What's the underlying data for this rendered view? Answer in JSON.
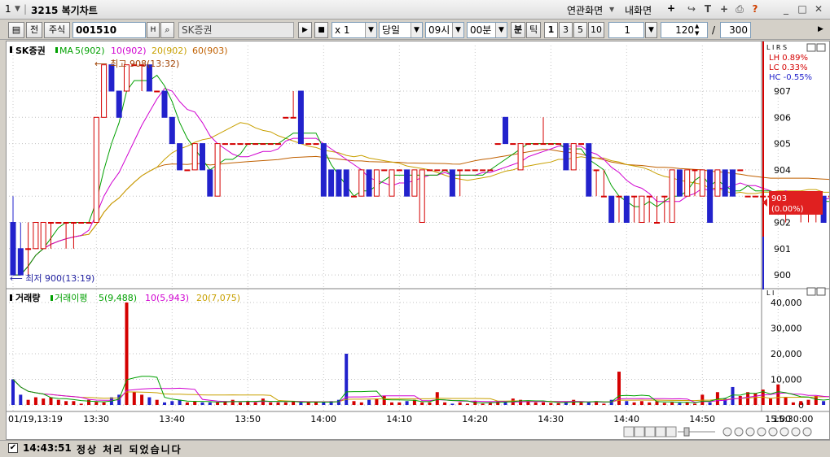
{
  "window": {
    "screen_no": "1",
    "title": "3215  복기차트",
    "link_screen": "연관화면",
    "my_screen": "내화면"
  },
  "toolbar": {
    "prefix": "전",
    "market": "주식",
    "code": "001510",
    "h_label": "H",
    "stock_name": "SK증권",
    "multiplier": "x 1",
    "period": "당일",
    "start_time": "09시",
    "start_minute": "00분",
    "unit_min": "분",
    "unit_tick": "틱",
    "intervals": [
      "1",
      "3",
      "5",
      "10"
    ],
    "interval_value": "1",
    "view_count": "120",
    "total_count": "300"
  },
  "price_panel": {
    "legend": {
      "name": "SK증권",
      "ma_label": "MA",
      "ma5": "5(902)",
      "ma10": "10(902)",
      "ma20": "20(902)",
      "ma60": "60(903)"
    },
    "high_note": "최고 908(13:32)",
    "low_note": "최저 900(13:19)",
    "corner_label": "L I R S",
    "stats": {
      "lh": "LH   0.89%",
      "lc": "LC   0.33%",
      "hc": "HC  -0.55%"
    },
    "current_price": "903",
    "current_change": "(0.00%)",
    "y_ticks": [
      "907",
      "906",
      "905",
      "904",
      "903",
      "902",
      "901",
      "900"
    ]
  },
  "volume_panel": {
    "legend": {
      "name": "거래량",
      "avg_label": "거래이평",
      "avg5": "5(9,488)",
      "avg10": "10(5,943)",
      "avg20": "20(7,075)"
    },
    "corner_label": "L I",
    "y_ticks": [
      "40,000",
      "30,000",
      "20,000",
      "10,000",
      "0"
    ]
  },
  "x_axis": {
    "labels": [
      "01/19,13:19",
      "13:30",
      "13:40",
      "13:50",
      "14:00",
      "14:10",
      "14:20",
      "14:30",
      "14:40",
      "14:50",
      "15:00",
      "15:10"
    ],
    "end_label": "15:30:00"
  },
  "colors": {
    "up": "#d40000",
    "down": "#2222cc",
    "ma5": "#00a000",
    "ma10": "#d000d0",
    "ma20": "#c8a000",
    "ma60": "#c06000"
  },
  "status": {
    "time": "14:43:51",
    "message": "정상 처리 되었습니다"
  },
  "chart_data": [
    {
      "type": "candlestick",
      "title": "SK증권",
      "x_start": "13:19",
      "x_interval_minutes": 1,
      "ylim": [
        899.5,
        908.5
      ],
      "candles": [
        [
          902,
          903,
          900,
          900
        ],
        [
          901,
          902,
          900,
          900
        ],
        [
          901,
          902,
          900,
          901
        ],
        [
          901,
          902,
          901,
          902
        ],
        [
          901,
          902,
          901,
          902
        ],
        [
          902,
          902,
          901,
          902
        ],
        [
          902,
          902,
          902,
          902
        ],
        [
          902,
          902,
          901,
          902
        ],
        [
          902,
          902,
          901,
          902
        ],
        [
          902,
          902,
          902,
          902
        ],
        [
          902,
          902,
          902,
          902
        ],
        [
          902,
          906,
          902,
          906
        ],
        [
          906,
          908,
          906,
          908
        ],
        [
          908,
          908,
          907,
          907
        ],
        [
          907,
          907,
          906,
          906
        ],
        [
          907,
          908,
          907,
          908
        ],
        [
          908,
          908,
          908,
          908
        ],
        [
          908,
          908,
          907,
          908
        ],
        [
          908,
          908,
          907,
          907
        ],
        [
          907,
          907,
          907,
          907
        ],
        [
          907,
          907,
          906,
          906
        ],
        [
          906,
          906,
          905,
          905
        ],
        [
          905,
          905,
          904,
          904
        ],
        [
          904,
          904,
          904,
          904
        ],
        [
          904,
          905,
          904,
          905
        ],
        [
          905,
          905,
          904,
          904
        ],
        [
          904,
          904,
          903,
          903
        ],
        [
          903,
          905,
          903,
          905
        ],
        [
          905,
          905,
          905,
          905
        ],
        [
          905,
          905,
          905,
          905
        ],
        [
          905,
          905,
          905,
          905
        ],
        [
          905,
          905,
          905,
          905
        ],
        [
          905,
          905,
          905,
          905
        ],
        [
          905,
          905,
          905,
          905
        ],
        [
          905,
          905,
          905,
          905
        ],
        [
          905,
          905,
          905,
          905
        ],
        [
          906,
          906,
          906,
          906
        ],
        [
          906,
          907,
          906,
          906
        ],
        [
          907,
          907,
          905,
          905
        ],
        [
          905,
          905,
          905,
          905
        ],
        [
          905,
          905,
          905,
          905
        ],
        [
          905,
          905,
          903,
          903
        ],
        [
          904,
          904,
          903,
          903
        ],
        [
          904,
          904,
          903,
          903
        ],
        [
          904,
          904,
          903,
          903
        ],
        [
          903,
          903,
          903,
          903
        ],
        [
          903,
          904,
          903,
          904
        ],
        [
          904,
          904,
          903,
          903
        ],
        [
          903,
          904,
          903,
          904
        ],
        [
          904,
          904,
          904,
          904
        ],
        [
          903,
          904,
          903,
          904
        ],
        [
          904,
          904,
          904,
          904
        ],
        [
          904,
          904,
          903,
          903
        ],
        [
          903,
          904,
          903,
          904
        ],
        [
          902,
          904,
          902,
          904
        ],
        [
          904,
          904,
          904,
          904
        ],
        [
          904,
          904,
          904,
          904
        ],
        [
          904,
          904,
          904,
          904
        ],
        [
          904,
          904,
          903,
          903
        ],
        [
          904,
          904,
          903,
          904
        ],
        [
          904,
          904,
          904,
          904
        ],
        [
          904,
          904,
          904,
          904
        ],
        [
          904,
          904,
          904,
          904
        ],
        [
          904,
          904,
          904,
          904
        ],
        [
          905,
          905,
          905,
          905
        ],
        [
          906,
          906,
          905,
          905
        ],
        [
          905,
          905,
          905,
          905
        ],
        [
          904,
          905,
          904,
          905
        ],
        [
          905,
          905,
          905,
          905
        ],
        [
          905,
          905,
          905,
          905
        ],
        [
          905,
          906,
          905,
          905
        ],
        [
          905,
          905,
          905,
          905
        ],
        [
          905,
          905,
          905,
          905
        ],
        [
          905,
          905,
          904,
          904
        ],
        [
          904,
          905,
          904,
          905
        ],
        [
          905,
          905,
          905,
          905
        ],
        [
          905,
          905,
          903,
          903
        ],
        [
          904,
          904,
          903,
          904
        ],
        [
          903,
          904,
          903,
          903
        ],
        [
          903,
          903,
          902,
          902
        ],
        [
          903,
          903,
          902,
          903
        ],
        [
          903,
          903,
          902,
          902
        ],
        [
          903,
          903,
          902,
          903
        ],
        [
          902,
          903,
          902,
          903
        ],
        [
          903,
          903,
          902,
          903
        ],
        [
          902,
          903,
          902,
          902
        ],
        [
          903,
          903,
          902,
          903
        ],
        [
          902,
          904,
          902,
          904
        ],
        [
          904,
          904,
          903,
          903
        ],
        [
          903,
          904,
          903,
          904
        ],
        [
          904,
          904,
          903,
          904
        ],
        [
          903,
          904,
          903,
          904
        ],
        [
          904,
          904,
          902,
          902
        ],
        [
          903,
          904,
          903,
          904
        ],
        [
          904,
          904,
          903,
          903
        ],
        [
          904,
          904,
          903,
          903
        ],
        [
          904,
          904,
          904,
          904
        ],
        [
          903,
          903,
          903,
          903
        ],
        [
          903,
          903,
          903,
          903
        ],
        [
          903,
          903,
          903,
          903
        ],
        [
          903,
          903,
          903,
          903
        ],
        [
          903,
          903,
          903,
          903
        ],
        [
          903,
          903,
          902,
          903
        ],
        [
          903,
          903,
          903,
          903
        ],
        [
          903,
          903,
          902,
          903
        ],
        [
          903,
          903,
          902,
          903
        ],
        [
          903,
          903,
          902,
          903
        ],
        [
          903,
          903,
          902,
          902
        ],
        [
          903,
          903,
          903,
          903
        ],
        [
          903,
          903,
          903,
          903
        ],
        [
          902,
          903,
          902,
          903
        ],
        [
          903,
          903,
          902,
          902
        ],
        [
          902,
          903,
          902,
          902
        ],
        [
          903,
          903,
          901,
          901
        ],
        [
          902,
          902,
          902,
          902
        ],
        [
          902,
          903,
          902,
          902
        ],
        [
          902,
          902,
          901,
          901
        ],
        [
          902,
          902,
          902,
          902
        ],
        [
          902,
          902,
          901,
          901
        ],
        [
          902,
          902,
          901,
          902
        ],
        [
          902,
          902,
          902,
          902
        ],
        [
          901,
          902,
          901,
          902
        ],
        [
          902,
          902,
          901,
          901
        ],
        [
          901,
          902,
          901,
          902
        ],
        [
          902,
          902,
          902,
          902
        ],
        [
          902,
          902,
          901,
          902
        ],
        [
          902,
          902,
          901,
          901
        ],
        [
          901,
          902,
          901,
          902
        ],
        [
          902,
          902,
          901,
          901
        ]
      ]
    },
    {
      "type": "bar",
      "title": "거래량",
      "ylim": [
        0,
        40000
      ],
      "values": [
        10000,
        4000,
        2000,
        3000,
        2500,
        3000,
        2000,
        1500,
        1500,
        500,
        2000,
        1200,
        1000,
        3000,
        4000,
        40000,
        5000,
        4000,
        3000,
        2000,
        1000,
        1500,
        2000,
        1000,
        1500,
        1000,
        1000,
        1000,
        1500,
        2000,
        1000,
        1500,
        1000,
        2500,
        1000,
        1000,
        1000,
        1500,
        1000,
        1000,
        1000,
        1000,
        1500,
        2000,
        20000,
        1500,
        1000,
        2000,
        2500,
        3500,
        1000,
        1000,
        1500,
        2000,
        1000,
        1000,
        5000,
        1000,
        500,
        1000,
        500,
        1500,
        500,
        1000,
        1500,
        1000,
        2500,
        2000,
        1500,
        1000,
        1000,
        800,
        700,
        1200,
        2000,
        1000,
        1000,
        1500,
        500,
        2000,
        13000,
        1500,
        1000,
        1500,
        1000,
        1500,
        800,
        1000,
        800,
        1000,
        500,
        4000,
        1000,
        5000,
        2500,
        7000,
        3500,
        5000,
        4500,
        6000,
        2500,
        8000,
        3000,
        1000,
        1500,
        2000,
        3500,
        1500,
        2500,
        1500,
        2500,
        3000,
        4000,
        8500,
        3500,
        3000,
        3500,
        22000,
        3500,
        1500,
        2500,
        6000,
        18000,
        4500,
        24000,
        17000,
        2000,
        8000,
        13000,
        5000,
        7000,
        3000,
        4000,
        3000,
        6000,
        4500,
        1000,
        5000,
        5500,
        3500,
        36000
      ]
    }
  ]
}
